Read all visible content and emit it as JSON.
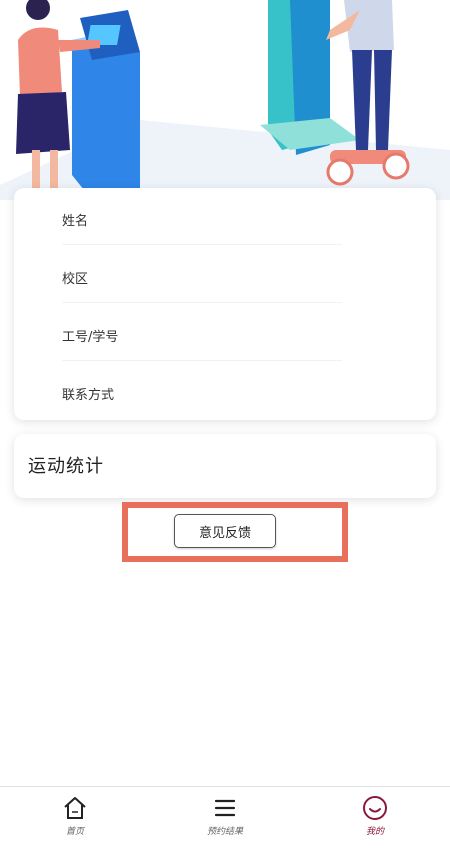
{
  "profile_fields": {
    "name_label": "姓名",
    "campus_label": "校区",
    "id_label": "工号/学号",
    "contact_label": "联系方式"
  },
  "stats": {
    "title": "运动统计"
  },
  "feedback": {
    "button_label": "意见反馈"
  },
  "bottom_nav": {
    "home_label": "首页",
    "booking_label": "预约结果",
    "mine_label": "我的"
  },
  "colors": {
    "highlight": "#e86f5c",
    "active_tab": "#8a1a3a"
  }
}
